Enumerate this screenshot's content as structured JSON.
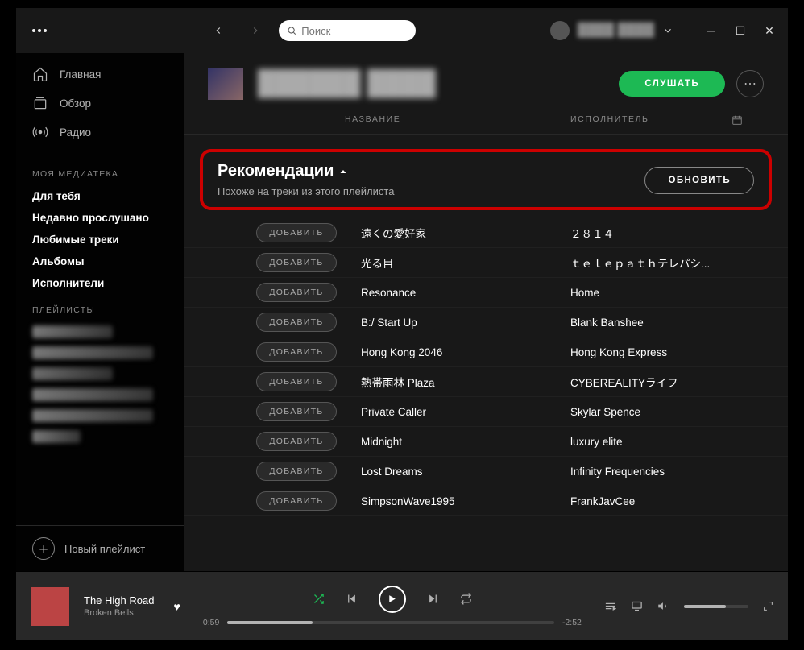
{
  "header": {
    "search_placeholder": "Поиск",
    "user_name": "████ ████"
  },
  "sidebar": {
    "nav": {
      "home": "Главная",
      "browse": "Обзор",
      "radio": "Радио"
    },
    "library_heading": "МОЯ МЕДИАТЕКА",
    "library": {
      "for_you": "Для тебя",
      "recent": "Недавно прослушано",
      "liked": "Любимые треки",
      "albums": "Альбомы",
      "artists": "Исполнители"
    },
    "playlists_heading": "ПЛЕЙЛИСТЫ",
    "new_playlist": "Новый плейлист"
  },
  "main": {
    "playlist_title_blur": "██████ ████",
    "play_label": "СЛУШАТЬ",
    "columns": {
      "title": "НАЗВАНИЕ",
      "artist": "ИСПОЛНИТЕЛЬ"
    },
    "recommendations": {
      "title": "Рекомендации",
      "subtitle": "Похоже на треки из этого плейлиста",
      "refresh": "ОБНОВИТЬ"
    },
    "add_label": "ДОБАВИТЬ",
    "tracks": [
      {
        "title": "遠くの愛好家",
        "artist": "２８１４"
      },
      {
        "title": "光る目",
        "artist": "ｔｅｌｅｐａｔｈテレパシ..."
      },
      {
        "title": "Resonance",
        "artist": "Home"
      },
      {
        "title": "B:/ Start Up",
        "artist": "Blank Banshee"
      },
      {
        "title": "Hong Kong 2046",
        "artist": "Hong Kong Express"
      },
      {
        "title": "熱帯雨林 Plaza",
        "artist": "CYBEREALITYライフ"
      },
      {
        "title": "Private Caller",
        "artist": "Skylar Spence"
      },
      {
        "title": "Midnight",
        "artist": "luxury elite"
      },
      {
        "title": "Lost Dreams",
        "artist": "Infinity Frequencies"
      },
      {
        "title": "SimpsonWave1995",
        "artist": "FrankJavCee"
      }
    ]
  },
  "player": {
    "track": "The High Road",
    "artist": "Broken Bells",
    "elapsed": "0:59",
    "remaining": "-2:52"
  }
}
